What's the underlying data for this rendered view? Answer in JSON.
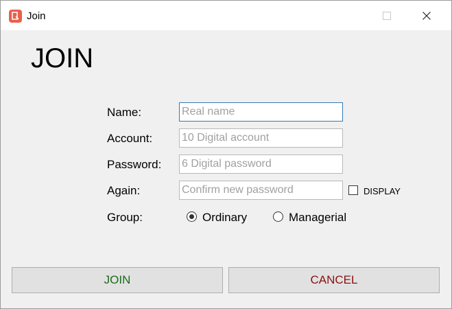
{
  "window": {
    "title": "Join",
    "accent_color": "#e8604c"
  },
  "heading": "JOIN",
  "form": {
    "name": {
      "label": "Name:",
      "placeholder": "Real name",
      "value": ""
    },
    "account": {
      "label": "Account:",
      "placeholder": "10 Digital account",
      "value": ""
    },
    "password": {
      "label": "Password:",
      "placeholder": "6 Digital password",
      "value": ""
    },
    "again": {
      "label": "Again:",
      "placeholder": "Confirm new password",
      "value": ""
    },
    "display": {
      "label": "DISPLAY",
      "checked": false
    },
    "group": {
      "label": "Group:",
      "options": [
        "Ordinary",
        "Managerial"
      ],
      "selected": "Ordinary"
    }
  },
  "buttons": {
    "join": "JOIN",
    "cancel": "CANCEL",
    "join_color": "#1a6b1a",
    "cancel_color": "#8b1010"
  }
}
